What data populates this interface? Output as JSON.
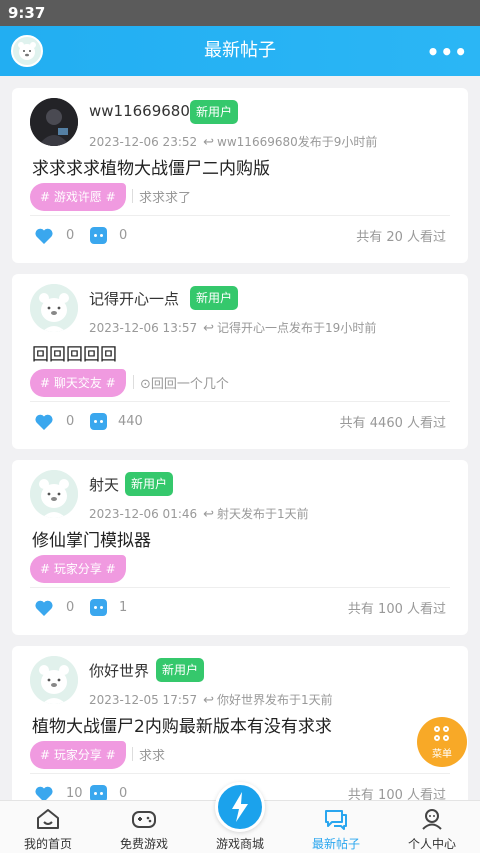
{
  "statusbar": {
    "time": "9:37"
  },
  "header": {
    "title": "最新帖子",
    "more": "•••"
  },
  "posts": [
    {
      "username": "ww11669680",
      "badge": "新用户",
      "date": "2023-12-06 23:52",
      "published": "ww11669680发布于9小时前",
      "title": "求求求求植物大战僵尸二内购版",
      "tag": "# 游戏许愿 #",
      "excerpt": "求求求了",
      "likes": "0",
      "comments": "0",
      "views": "共有 20 人看过"
    },
    {
      "username": "记得开心一点",
      "badge": "新用户",
      "date": "2023-12-06 13:57",
      "published": "记得开心一点发布于19小时前",
      "title": "回回回回回",
      "tag": "# 聊天交友 #",
      "excerpt": "⊙回回一个几个",
      "likes": "0",
      "comments": "440",
      "views": "共有 4460 人看过"
    },
    {
      "username": "射天",
      "badge": "新用户",
      "date": "2023-12-06 01:46",
      "published": "射天发布于1天前",
      "title": "修仙掌门模拟器",
      "tag": "# 玩家分享 #",
      "excerpt": "",
      "likes": "0",
      "comments": "1",
      "views": "共有 100 人看过"
    },
    {
      "username": "你好世界",
      "badge": "新用户",
      "date": "2023-12-05 17:57",
      "published": "你好世界发布于1天前",
      "title": "植物大战僵尸2内购最新版本有没有求求",
      "tag": "# 玩家分享 #",
      "excerpt": "求求",
      "likes": "10",
      "comments": "0",
      "views": "共有 100 人看过"
    }
  ],
  "fab": {
    "label": "菜单"
  },
  "tabs": [
    {
      "label": "我的首页",
      "icon": "home-icon"
    },
    {
      "label": "免费游戏",
      "icon": "gamepad-icon"
    },
    {
      "label": "游戏商城",
      "icon": "lightning-icon"
    },
    {
      "label": "最新帖子",
      "icon": "chat-icon"
    },
    {
      "label": "个人中心",
      "icon": "person-icon"
    }
  ],
  "colors": {
    "accent": "#22aef2",
    "badge": "#35c86c",
    "tag": "#f09ae0",
    "fab": "#f8a927"
  }
}
